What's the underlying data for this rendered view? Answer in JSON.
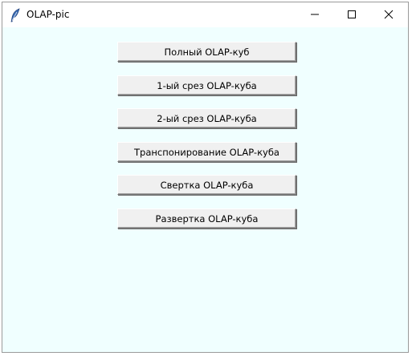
{
  "window": {
    "title": "OLAP-pic",
    "client_background": "#f0ffff"
  },
  "icons": {
    "app": "feather-icon",
    "minimize": "minimize-icon",
    "maximize": "maximize-icon",
    "close": "close-icon"
  },
  "buttons": [
    {
      "label": "Полный OLAP-куб"
    },
    {
      "label": "1-ый срез OLAP-куба"
    },
    {
      "label": "2-ый срез OLAP-куба"
    },
    {
      "label": "Транспонирование OLAP-куба"
    },
    {
      "label": "Свертка OLAP-куба"
    },
    {
      "label": "Развертка OLAP-куба"
    }
  ]
}
